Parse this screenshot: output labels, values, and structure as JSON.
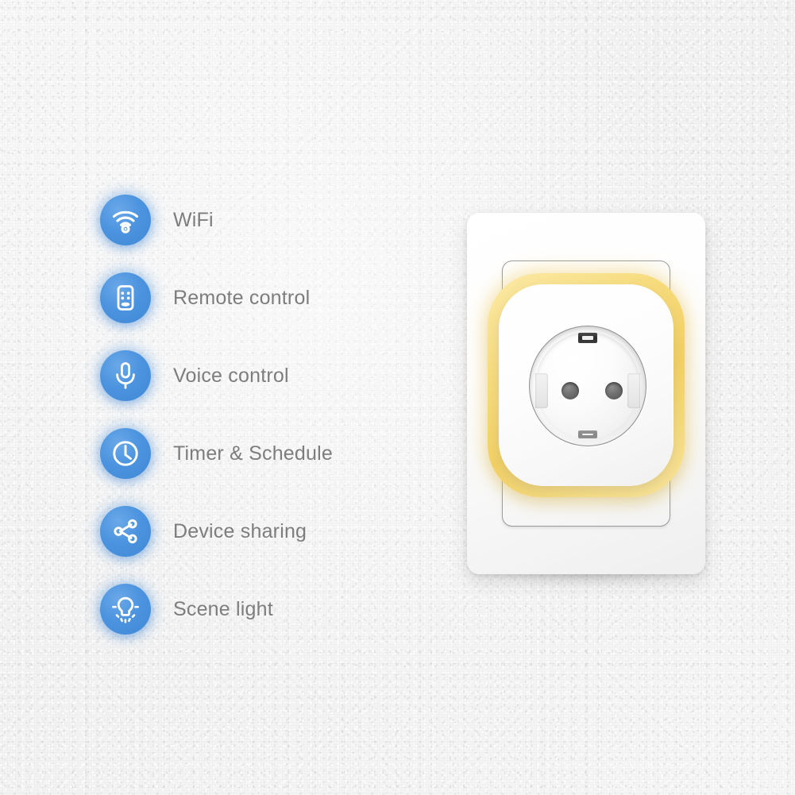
{
  "page": {
    "background_color": "#f3f3f3",
    "accent_color": "#4c94df",
    "label_color": "#7d7d7d",
    "glow_ring_color": "#f2d064"
  },
  "features": [
    {
      "icon": "wifi-icon",
      "label": "WiFi"
    },
    {
      "icon": "remote-control-icon",
      "label": "Remote control"
    },
    {
      "icon": "microphone-icon",
      "label": "Voice control"
    },
    {
      "icon": "clock-icon",
      "label": "Timer & Schedule"
    },
    {
      "icon": "share-nodes-icon",
      "label": "Device sharing"
    },
    {
      "icon": "light-bulb-icon",
      "label": "Scene light"
    }
  ],
  "product": {
    "name": "smart-wall-socket",
    "plate": "wall-plate",
    "module": "smart-socket-module",
    "socket_type": "schuko-outlet",
    "indicator": "yellow-glow-ring"
  }
}
